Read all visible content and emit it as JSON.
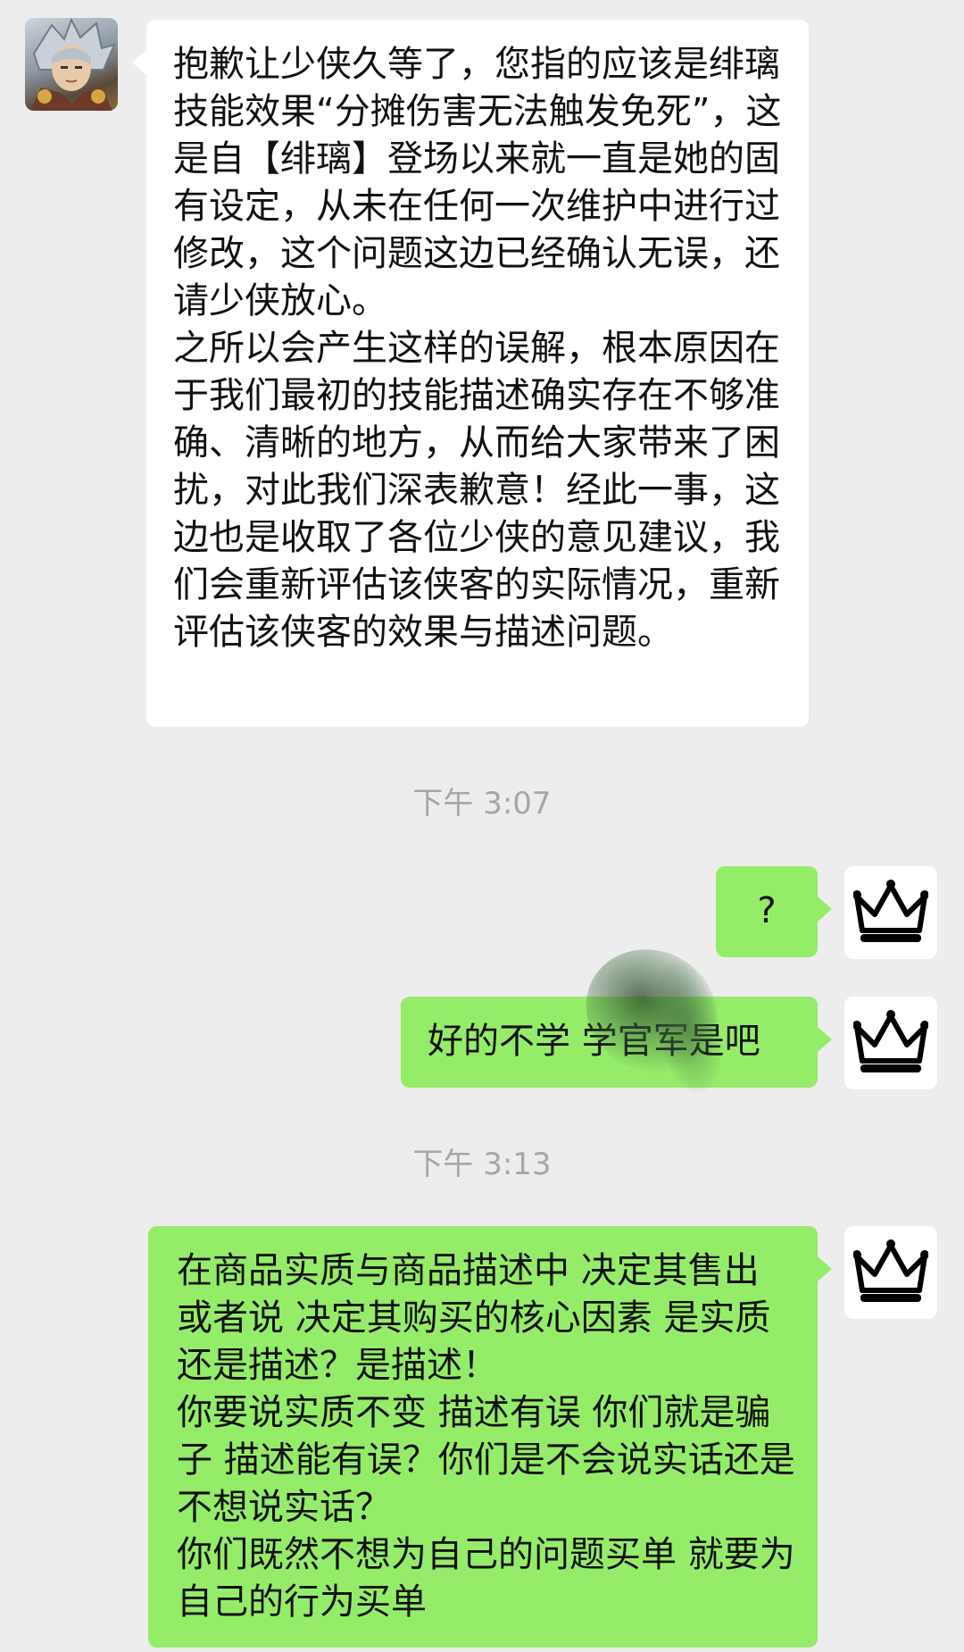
{
  "colors": {
    "background": "#ededed",
    "incoming_bubble": "#ffffff",
    "outgoing_bubble": "#95ec69",
    "timestamp_text": "#a6a6a6"
  },
  "messages": [
    {
      "side": "incoming",
      "avatar_icon": "swordsman-portrait-icon",
      "text": "抱歉让少侠久等了，您指的应该是绯璃技能效果“分摊伤害无法触发免死”，这是自【绯璃】登场以来就一直是她的固有设定，从未在任何一次维护中进行过修改，这个问题这边已经确认无误，还请少侠放心。\n之所以会产生这样的误解，根本原因在于我们最初的技能描述确实存在不够准确、清晰的地方，从而给大家带来了困扰，对此我们深表歉意！经此一事，这边也是收取了各位少侠的意见建议，我们会重新评估该侠客的实际情况，重新评估该侠客的效果与描述问题。"
    },
    {
      "side": "outgoing",
      "avatar_icon": "crown-icon",
      "text": "?"
    },
    {
      "side": "outgoing",
      "avatar_icon": "crown-icon",
      "text": "好的不学 学官军是吧"
    },
    {
      "side": "outgoing",
      "avatar_icon": "crown-icon",
      "text": "在商品实质与商品描述中 决定其售出 或者说 决定其购买的核心因素 是实质还是描述？是描述！\n你要说实质不变 描述有误 你们就是骗子 描述能有误？你们是不会说实话还是不想说实话？\n你们既然不想为自己的问题买单 就要为自己的行为买单"
    }
  ],
  "timestamps": [
    "下午 3:07",
    "下午 3:13"
  ]
}
